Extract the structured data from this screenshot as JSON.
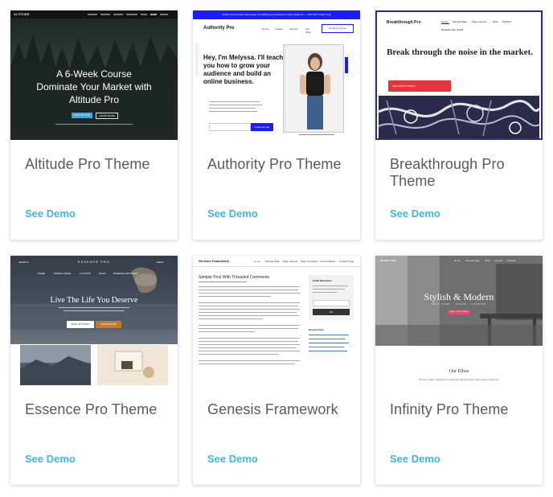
{
  "cards": [
    {
      "title": "Altitude Pro Theme",
      "link": "See Demo",
      "preview": {
        "logo": "ALTITUDE",
        "heading_line1": "A 6-Week Course",
        "heading_line2": "Dominate Your Market with",
        "heading_line3": "Altitude Pro",
        "btn1": "SIGN UP NOW",
        "btn2": "LEARN MORE"
      }
    },
    {
      "title": "Authority Pro Theme",
      "link": "See Demo",
      "preview": {
        "banner": "Check out my brand new course on building and growing an online audience — 25% OFF Today Only!",
        "logo": "Authority Pro",
        "nav": [
          "Home",
          "Images",
          "Layouts",
          "Our Shop"
        ],
        "nav_btn": "Authority Upsell",
        "hero": "Hey, I'm Melyssa. I'll teach you how to grow your audience and build an online business.",
        "subscribe": "Subscribe Me"
      }
    },
    {
      "title": "Breakthrough Pro Theme",
      "link": "See Demo",
      "preview": {
        "logo": "Breakthrough Pro",
        "nav": [
          "Home",
          "Sample Page",
          "Page Layouts",
          "Shop",
          "Portfolio"
        ],
        "nav2": "Breakthrough Upsell",
        "hero": "Break through the noise in the market.",
        "btn": "SEE HOW STUDIOS"
      }
    },
    {
      "title": "Essence Pro Theme",
      "link": "See Demo",
      "preview": {
        "search": "SEARCH",
        "logo": "ESSENCE PRO",
        "menu": "MENU",
        "nav": [
          "HOME",
          "SAMPLE PAGE",
          "LAYOUTS",
          "SHOP",
          "ESSENCE SETTINGS"
        ],
        "hero": "Live The Life You Deserve",
        "btn1": "SIGN UP TODAY",
        "btn2": "LEARN MORE"
      }
    },
    {
      "title": "Genesis Framework",
      "link": "See Demo",
      "preview": {
        "logo": "Genesis Framework",
        "nav": [
          "Home",
          "Sample Page",
          "Page Layouts",
          "Page Templates",
          "Content Bases",
          "Contact Page"
        ],
        "post_title": "Sample Post With Threaded Comments",
        "sidebar_title": "Email Newsletter",
        "sidebar_btn": "GO",
        "recent": "Recent Posts"
      }
    },
    {
      "title": "Infinity Pro Theme",
      "link": "See Demo",
      "preview": {
        "logo": "INFINITY PRO",
        "nav": [
          "Home",
          "Sample Page",
          "Shop",
          "Layouts",
          "Portfolio"
        ],
        "hero1": "Stylish & Modern",
        "hero2": "NEW YORK · PARIS · LONDON",
        "btn": "START YOUR JOURNEY",
        "section": "Our Ethos",
        "section_text": "We help creative entrepreneurs build their digital business by focusing on three key"
      }
    }
  ]
}
